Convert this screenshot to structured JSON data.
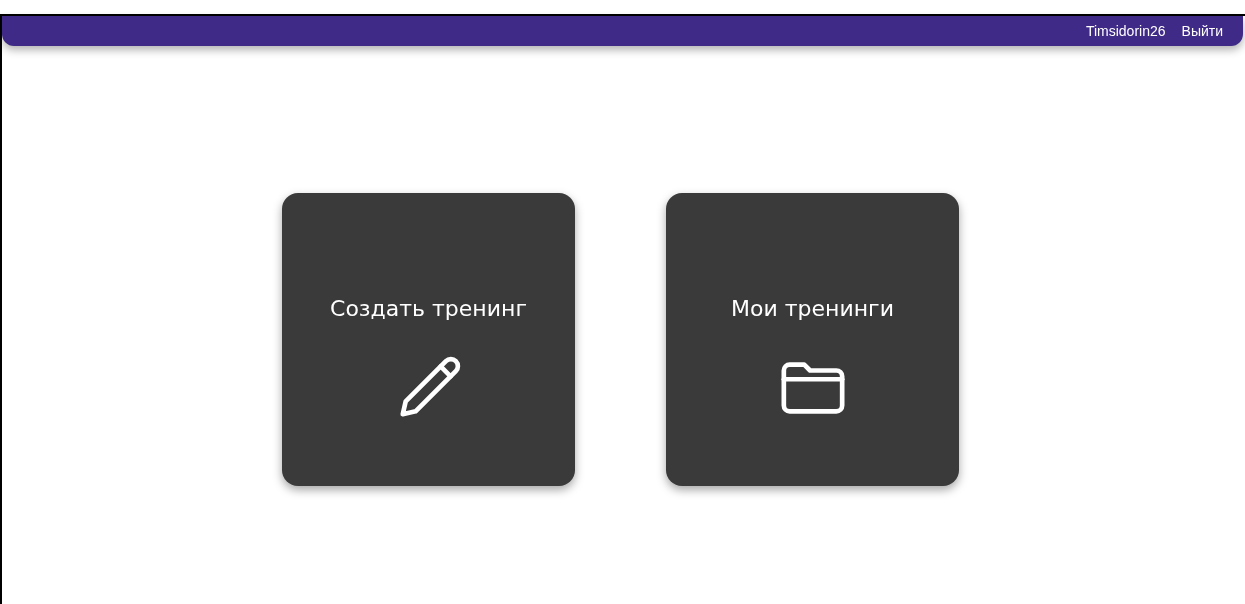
{
  "header": {
    "username": "Timsidorin26",
    "logout": "Выйти"
  },
  "cards": [
    {
      "kind": "create",
      "title": "Создать тренинг"
    },
    {
      "kind": "list",
      "title": "Мои тренинги"
    }
  ]
}
